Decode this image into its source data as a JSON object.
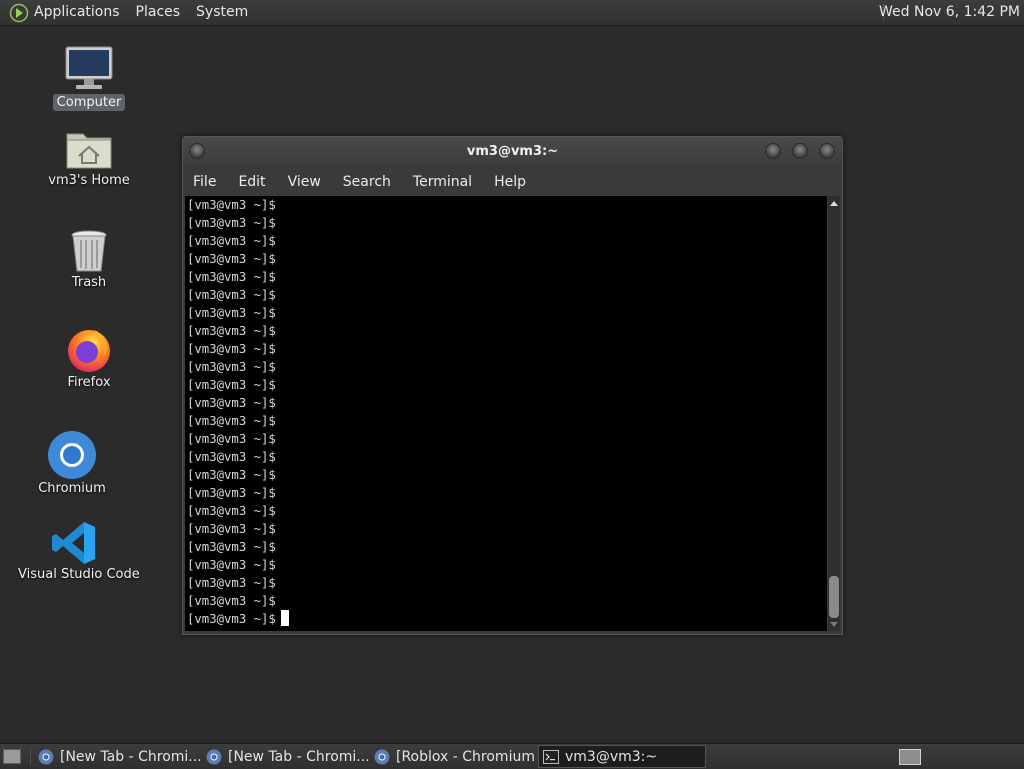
{
  "top_panel": {
    "menus": [
      "Applications",
      "Places",
      "System"
    ],
    "clock": "Wed Nov  6,  1:42 PM"
  },
  "desktop": {
    "icons": [
      {
        "label": "Computer",
        "icon": "computer-icon"
      },
      {
        "label": "vm3's Home",
        "icon": "home-folder-icon"
      },
      {
        "label": "Trash",
        "icon": "trash-icon"
      },
      {
        "label": "Firefox",
        "icon": "firefox-icon"
      },
      {
        "label": "Chromium",
        "icon": "chromium-icon"
      },
      {
        "label": "Visual Studio Code",
        "icon": "vscode-icon"
      }
    ]
  },
  "terminal": {
    "title": "vm3@vm3:~",
    "menu": [
      "File",
      "Edit",
      "View",
      "Search",
      "Terminal",
      "Help"
    ],
    "prompt": "[vm3@vm3 ~]$",
    "line_count": 24
  },
  "taskbar": {
    "tasks": [
      {
        "label": "[New Tab - Chromi...",
        "icon": "chromium-icon",
        "active": false
      },
      {
        "label": "[New Tab - Chromi...",
        "icon": "chromium-icon",
        "active": false
      },
      {
        "label": "[Roblox - Chromium]",
        "icon": "chromium-icon",
        "active": false
      },
      {
        "label": "vm3@vm3:~",
        "icon": "terminal-icon",
        "active": true
      }
    ]
  },
  "colors": {
    "desktop_bg": "#2b2b2b",
    "panel_bg": "#363636",
    "terminal_bg": "#000000",
    "terminal_fg": "#d9d9d9"
  }
}
